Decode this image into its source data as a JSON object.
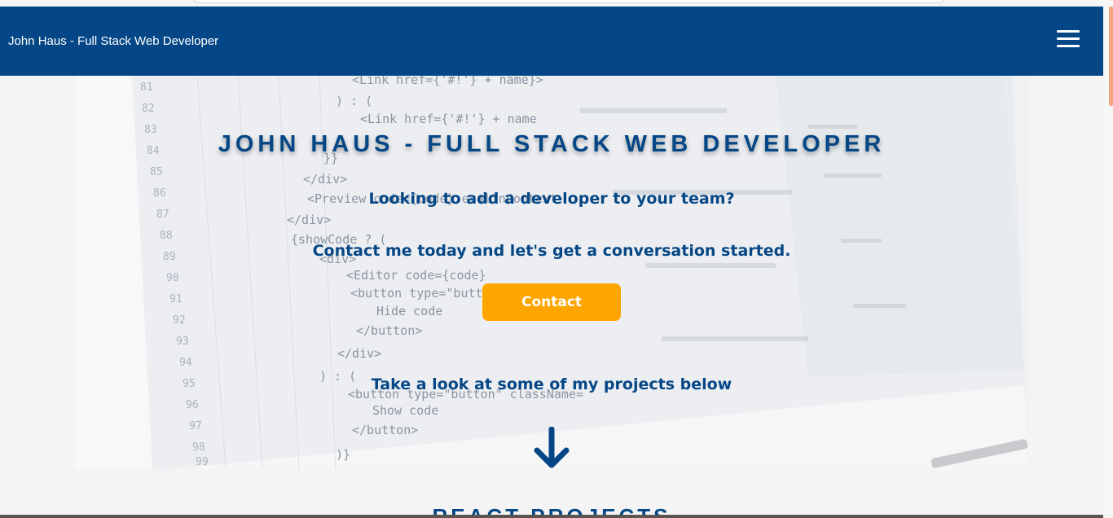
{
  "navbar": {
    "brand": "John Haus - Full Stack Web Developer",
    "menu_icon": "hamburger-menu-icon"
  },
  "hero": {
    "title": "JOHN HAUS - FULL STACK WEB DEVELOPER",
    "tagline": "Looking to add a developer to your team?",
    "cta_text": "Contact me today and let's get a conversation started.",
    "contact_label": "Contact",
    "projects_hint": "Take a look at some of my projects below",
    "arrow_icon": "arrow-down-icon",
    "background_image": "code-editor-screen-photo"
  },
  "section": {
    "heading": "REACT PROJECTS"
  },
  "colors": {
    "primary": "#054786",
    "accent": "#ffa500",
    "background": "#f4f4f4",
    "scroll_thumb": "#f2a47c"
  }
}
